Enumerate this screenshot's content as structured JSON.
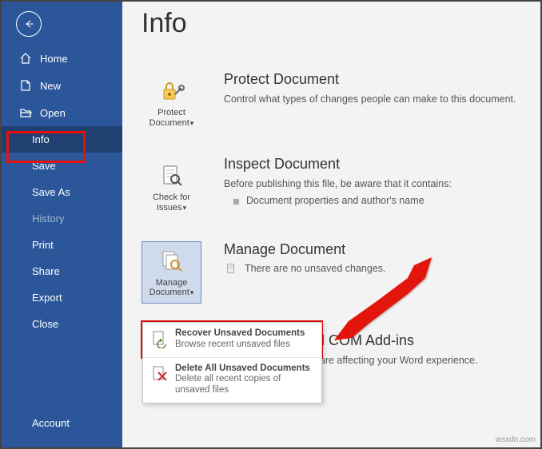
{
  "sidebar": {
    "items": [
      {
        "label": "Home"
      },
      {
        "label": "New"
      },
      {
        "label": "Open"
      },
      {
        "label": "Info"
      },
      {
        "label": "Save"
      },
      {
        "label": "Save As"
      },
      {
        "label": "History"
      },
      {
        "label": "Print"
      },
      {
        "label": "Share"
      },
      {
        "label": "Export"
      },
      {
        "label": "Close"
      }
    ],
    "account": "Account"
  },
  "page": {
    "title": "Info"
  },
  "protect": {
    "button": "Protect Document",
    "title": "Protect Document",
    "desc": "Control what types of changes people can make to this document."
  },
  "inspect": {
    "button": "Check for Issues",
    "title": "Inspect Document",
    "desc": "Before publishing this file, be aware that it contains:",
    "bullet1": "Document properties and author's name"
  },
  "manage": {
    "button": "Manage Document",
    "title": "Manage Document",
    "status": "There are no unsaved changes."
  },
  "addins": {
    "title_partial": "ed COM Add-ins",
    "desc_partial": "at are affecting your Word experience."
  },
  "dropdown": {
    "item1_title": "Recover Unsaved Documents",
    "item1_sub": "Browse recent unsaved files",
    "item2_title": "Delete All Unsaved Documents",
    "item2_sub": "Delete all recent copies of unsaved files"
  },
  "watermark": "wsxdn.com"
}
